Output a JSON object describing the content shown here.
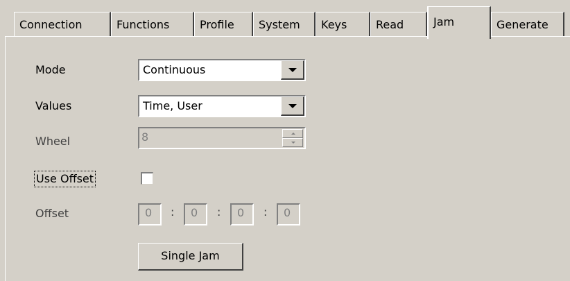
{
  "tabs": [
    {
      "label": "Connection"
    },
    {
      "label": "Functions"
    },
    {
      "label": "Profile"
    },
    {
      "label": "System"
    },
    {
      "label": "Keys"
    },
    {
      "label": "Read"
    },
    {
      "label": "Jam",
      "active": true
    },
    {
      "label": "Generate"
    }
  ],
  "form": {
    "mode": {
      "label": "Mode",
      "value": "Continuous"
    },
    "values": {
      "label": "Values",
      "value": "Time, User"
    },
    "wheel": {
      "label": "Wheel",
      "value": "8",
      "disabled": true
    },
    "use_offset": {
      "label": "Use Offset",
      "checked": false
    },
    "offset": {
      "label": "Offset",
      "fields": [
        "0",
        "0",
        "0",
        "0"
      ],
      "separator": ":",
      "disabled": true
    },
    "single_jam": {
      "label": "Single Jam"
    }
  },
  "icons": {
    "dropdown": "chevron-down-icon",
    "spin_up": "spin-up-icon",
    "spin_down": "spin-down-icon"
  },
  "colors": {
    "face": "#d4d0c8",
    "highlight": "#ffffff",
    "shadow": "#808080",
    "dark_shadow": "#404040"
  }
}
